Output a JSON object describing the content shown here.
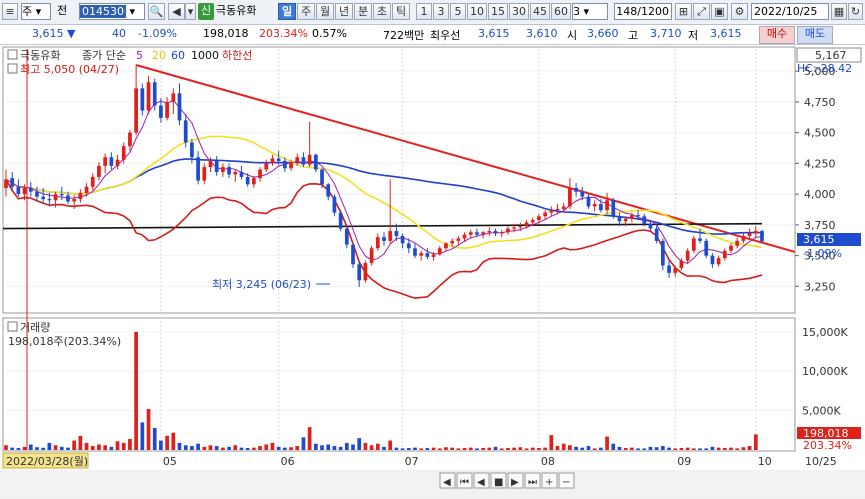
{
  "toolbar": {
    "mode": "주",
    "period_type": "전",
    "code": "014530",
    "stock_name": "극동유화",
    "tf_buttons": [
      "일",
      "주",
      "월",
      "년",
      "분",
      "초",
      "틱"
    ],
    "selected_tf": "일",
    "n_buttons": [
      "1",
      "3",
      "5",
      "10",
      "15",
      "30",
      "45",
      "60"
    ],
    "n_value": "3",
    "counter": "148/1200",
    "date": "2022/10/25"
  },
  "quote": {
    "price": "3,615",
    "arrow": "▼",
    "change": "40",
    "change_pct": "-1.09%",
    "volume": "198,018",
    "vol_ratio": "203.34%",
    "turnover": "0.57%",
    "amount": "722백만",
    "best_label": "최우선",
    "best_ask": "3,615",
    "best_bid": "3,610",
    "open_label": "시",
    "open": "3,660",
    "high_label": "고",
    "high": "3,710",
    "low_label": "저",
    "low": "3,615",
    "buy": "매수",
    "sell": "매도"
  },
  "legend": {
    "name": "극동유화",
    "ma_label": "종가 단순",
    "ma": [
      "5",
      "20",
      "60",
      "1000"
    ],
    "hline": "하한선",
    "top_right_value": "5,167",
    "hc_label": "HC:-28.42"
  },
  "annotations": {
    "max_label": "최고 5,050 (04/27)",
    "min_label": "최저 3,245 (06/23)"
  },
  "volume_legend": {
    "title": "거래량",
    "value": "198,018주(203.34%)",
    "tag_value": "198,018",
    "tag_pct": "203.34%"
  },
  "current_tag": {
    "price": "3,615",
    "pct": "-1.09%"
  },
  "x_axis": {
    "start_label": "2022/03/28(월)",
    "months": [
      "05",
      "06",
      "07",
      "08",
      "09",
      "10"
    ],
    "end_label": "10/25"
  },
  "colors": {
    "up": "#e0201a",
    "down": "#1f4ccf",
    "ma5": "#a21db6",
    "ma20": "#f2e020",
    "ma60": "#1f3fcf",
    "ma1000": "#111111",
    "lower_band": "#d71a1a",
    "trend": "#e62020"
  },
  "chart_data": {
    "type": "candlestick",
    "price_axis": {
      "ticks": [
        5000,
        4750,
        4500,
        4250,
        4000,
        3750,
        3500,
        3250
      ],
      "range": [
        3050,
        5180
      ]
    },
    "volume_axis": {
      "ticks": [
        "15,000K",
        "10,000K",
        "5,000K"
      ],
      "range": [
        0,
        16500
      ]
    },
    "ohlc_start_date": "2022-03-28",
    "ohlc": [
      [
        4050,
        4200,
        3980,
        4120
      ],
      [
        4130,
        4180,
        4020,
        4060
      ],
      [
        4060,
        4120,
        3980,
        4000
      ],
      [
        4000,
        4080,
        3950,
        4050
      ],
      [
        4050,
        4100,
        3980,
        4020
      ],
      [
        4020,
        4060,
        3940,
        3980
      ],
      [
        3980,
        4050,
        3920,
        3960
      ],
      [
        3960,
        4010,
        3900,
        3950
      ],
      [
        3950,
        4020,
        3890,
        4000
      ],
      [
        4000,
        4060,
        3950,
        3990
      ],
      [
        3990,
        4020,
        3920,
        3940
      ],
      [
        3940,
        3990,
        3880,
        3960
      ],
      [
        3960,
        4040,
        3930,
        4010
      ],
      [
        4010,
        4090,
        3980,
        4060
      ],
      [
        4060,
        4170,
        4030,
        4140
      ],
      [
        4140,
        4260,
        4110,
        4230
      ],
      [
        4230,
        4330,
        4170,
        4300
      ],
      [
        4300,
        4340,
        4200,
        4230
      ],
      [
        4230,
        4320,
        4200,
        4280
      ],
      [
        4280,
        4420,
        4250,
        4390
      ],
      [
        4390,
        4520,
        4350,
        4500
      ],
      [
        4500,
        5050,
        4480,
        4860
      ],
      [
        4860,
        4900,
        4640,
        4680
      ],
      [
        4680,
        4960,
        4650,
        4910
      ],
      [
        4910,
        4940,
        4680,
        4720
      ],
      [
        4720,
        4780,
        4580,
        4620
      ],
      [
        4620,
        4790,
        4600,
        4750
      ],
      [
        4750,
        4860,
        4650,
        4820
      ],
      [
        4820,
        4900,
        4560,
        4600
      ],
      [
        4600,
        4650,
        4380,
        4420
      ],
      [
        4420,
        4450,
        4250,
        4300
      ],
      [
        4300,
        4350,
        4080,
        4110
      ],
      [
        4110,
        4250,
        4080,
        4220
      ],
      [
        4220,
        4300,
        4180,
        4270
      ],
      [
        4270,
        4310,
        4150,
        4180
      ],
      [
        4180,
        4250,
        4140,
        4220
      ],
      [
        4220,
        4250,
        4130,
        4160
      ],
      [
        4160,
        4200,
        4100,
        4180
      ],
      [
        4180,
        4230,
        4120,
        4140
      ],
      [
        4140,
        4170,
        4060,
        4080
      ],
      [
        4080,
        4150,
        4050,
        4130
      ],
      [
        4130,
        4220,
        4100,
        4200
      ],
      [
        4200,
        4280,
        4180,
        4250
      ],
      [
        4250,
        4320,
        4230,
        4290
      ],
      [
        4290,
        4350,
        4240,
        4270
      ],
      [
        4270,
        4300,
        4180,
        4210
      ],
      [
        4210,
        4280,
        4190,
        4260
      ],
      [
        4260,
        4330,
        4230,
        4300
      ],
      [
        4300,
        4340,
        4220,
        4240
      ],
      [
        4240,
        4590,
        4220,
        4320
      ],
      [
        4320,
        4330,
        4180,
        4200
      ],
      [
        4200,
        4210,
        4050,
        4080
      ],
      [
        4080,
        4090,
        3950,
        3980
      ],
      [
        3980,
        4000,
        3820,
        3850
      ],
      [
        3850,
        3870,
        3700,
        3720
      ],
      [
        3720,
        3740,
        3560,
        3590
      ],
      [
        3590,
        3600,
        3400,
        3430
      ],
      [
        3430,
        3450,
        3245,
        3300
      ],
      [
        3300,
        3460,
        3280,
        3440
      ],
      [
        3440,
        3580,
        3420,
        3560
      ],
      [
        3560,
        3680,
        3540,
        3650
      ],
      [
        3650,
        3690,
        3580,
        3620
      ],
      [
        3620,
        4120,
        3600,
        3700
      ],
      [
        3700,
        3760,
        3620,
        3660
      ],
      [
        3660,
        3680,
        3560,
        3600
      ],
      [
        3600,
        3640,
        3520,
        3560
      ],
      [
        3560,
        3600,
        3480,
        3500
      ],
      [
        3500,
        3540,
        3460,
        3520
      ],
      [
        3520,
        3560,
        3470,
        3490
      ],
      [
        3490,
        3530,
        3460,
        3510
      ],
      [
        3510,
        3580,
        3500,
        3560
      ],
      [
        3560,
        3610,
        3540,
        3600
      ],
      [
        3600,
        3640,
        3570,
        3620
      ],
      [
        3620,
        3660,
        3590,
        3640
      ],
      [
        3640,
        3690,
        3610,
        3670
      ],
      [
        3670,
        3710,
        3640,
        3690
      ],
      [
        3690,
        3720,
        3650,
        3670
      ],
      [
        3670,
        3700,
        3640,
        3690
      ],
      [
        3690,
        3730,
        3660,
        3700
      ],
      [
        3700,
        3720,
        3660,
        3680
      ],
      [
        3680,
        3710,
        3650,
        3690
      ],
      [
        3690,
        3740,
        3670,
        3720
      ],
      [
        3720,
        3760,
        3690,
        3730
      ],
      [
        3730,
        3770,
        3700,
        3740
      ],
      [
        3740,
        3790,
        3720,
        3770
      ],
      [
        3770,
        3810,
        3740,
        3790
      ],
      [
        3790,
        3840,
        3760,
        3820
      ],
      [
        3820,
        3870,
        3790,
        3850
      ],
      [
        3850,
        3900,
        3820,
        3870
      ],
      [
        3870,
        3920,
        3840,
        3880
      ],
      [
        3880,
        3930,
        3850,
        3900
      ],
      [
        3900,
        4130,
        3880,
        4050
      ],
      [
        4050,
        4090,
        3980,
        4020
      ],
      [
        4020,
        4060,
        3950,
        3980
      ],
      [
        3980,
        4000,
        3880,
        3900
      ],
      [
        3900,
        3950,
        3860,
        3920
      ],
      [
        3920,
        3960,
        3850,
        3870
      ],
      [
        3870,
        4010,
        3840,
        3950
      ],
      [
        3950,
        3970,
        3800,
        3820
      ],
      [
        3820,
        3850,
        3740,
        3780
      ],
      [
        3780,
        3820,
        3740,
        3800
      ],
      [
        3800,
        3850,
        3770,
        3830
      ],
      [
        3830,
        3870,
        3790,
        3820
      ],
      [
        3820,
        3840,
        3740,
        3760
      ],
      [
        3760,
        3780,
        3700,
        3720
      ],
      [
        3720,
        3750,
        3600,
        3620
      ],
      [
        3620,
        3640,
        3380,
        3420
      ],
      [
        3420,
        3460,
        3320,
        3360
      ],
      [
        3360,
        3420,
        3330,
        3400
      ],
      [
        3400,
        3480,
        3380,
        3460
      ],
      [
        3460,
        3560,
        3440,
        3540
      ],
      [
        3540,
        3660,
        3520,
        3640
      ],
      [
        3640,
        3720,
        3600,
        3620
      ],
      [
        3620,
        3640,
        3480,
        3500
      ],
      [
        3500,
        3520,
        3400,
        3430
      ],
      [
        3430,
        3500,
        3410,
        3480
      ],
      [
        3480,
        3560,
        3460,
        3540
      ],
      [
        3540,
        3600,
        3520,
        3580
      ],
      [
        3580,
        3650,
        3560,
        3620
      ],
      [
        3620,
        3690,
        3600,
        3660
      ],
      [
        3660,
        3720,
        3640,
        3680
      ],
      [
        3680,
        3740,
        3650,
        3700
      ],
      [
        3700,
        3710,
        3615,
        3615
      ]
    ],
    "volume_k": [
      600,
      300,
      250,
      400,
      700,
      350,
      280,
      900,
      600,
      400,
      300,
      1200,
      1800,
      900,
      500,
      700,
      600,
      400,
      1100,
      900,
      1400,
      15000,
      3500,
      5200,
      2800,
      1200,
      1800,
      2200,
      900,
      600,
      500,
      800,
      400,
      600,
      500,
      300,
      400,
      600,
      300,
      250,
      300,
      500,
      700,
      900,
      400,
      300,
      350,
      500,
      1600,
      2900,
      800,
      600,
      700,
      500,
      400,
      900,
      700,
      1500,
      900,
      600,
      800,
      400,
      1200,
      300,
      200,
      250,
      300,
      200,
      250,
      300,
      200,
      350,
      300,
      200,
      250,
      300,
      200,
      250,
      300,
      400,
      200,
      250,
      300,
      350,
      200,
      300,
      250,
      300,
      1900,
      500,
      800,
      600,
      400,
      300,
      500,
      200,
      300,
      1700,
      800,
      400,
      250,
      300,
      200,
      200,
      400,
      350,
      500,
      300,
      200,
      250,
      300,
      200,
      200,
      200,
      400,
      300,
      250,
      300,
      200,
      350,
      500,
      1980
    ]
  }
}
